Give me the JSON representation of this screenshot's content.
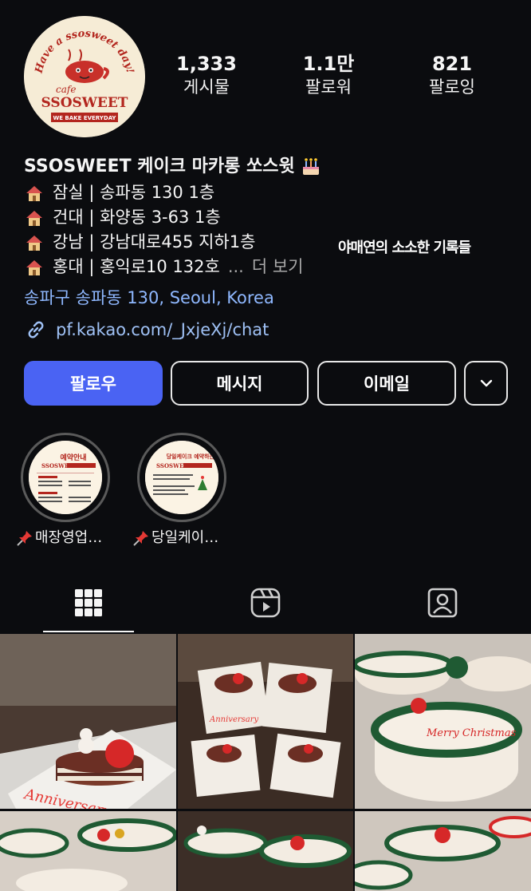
{
  "profile": {
    "avatar": {
      "arc_text": "Have a ssosweet day!",
      "cafe": "cafe",
      "brand": "SSOSWEET",
      "ribbon": "WE BAKE EVERYDAY"
    },
    "stats": [
      {
        "value": "1,333",
        "label": "게시물"
      },
      {
        "value": "1.1만",
        "label": "팔로워"
      },
      {
        "value": "821",
        "label": "팔로잉"
      }
    ]
  },
  "bio": {
    "name": "SSOSWEET 케이크 마카롱 쏘스윗",
    "lines": [
      "잠실 | 송파동 130 1층",
      "건대 | 화양동 3-63 1층",
      "강남 | 강남대로455 지하1층",
      "홍대 | 홍익로10 132호"
    ],
    "ellipsis": "...",
    "more": "더 보기",
    "overlay_note": "야매연의 소소한 기록들",
    "location": "송파구 송파동 130, Seoul, Korea",
    "link": "pf.kakao.com/_JxjeXj/chat"
  },
  "actions": {
    "follow": "팔로우",
    "message": "메시지",
    "email": "이메일"
  },
  "highlights": [
    {
      "caption": "매장영업…",
      "title": "예약안내",
      "brand": "SSOSWEET"
    },
    {
      "caption": "당일케이…",
      "title": "당일케이크 예약하는법",
      "brand": "SSOSWEET"
    }
  ],
  "tabs": [
    "grid-icon",
    "reels-icon",
    "tagged-icon"
  ],
  "grid": {
    "posts": [
      {
        "text": "Anniversary"
      },
      {
        "text": "Anniversary"
      },
      {
        "text": "Merry Christmas"
      },
      {
        "text": ""
      },
      {
        "text": ""
      },
      {
        "text": ""
      }
    ]
  },
  "colors": {
    "background": "#0b0c0f",
    "follow_button": "#4a63f3",
    "link": "#9fc1f5",
    "brand_red": "#b3261e"
  }
}
